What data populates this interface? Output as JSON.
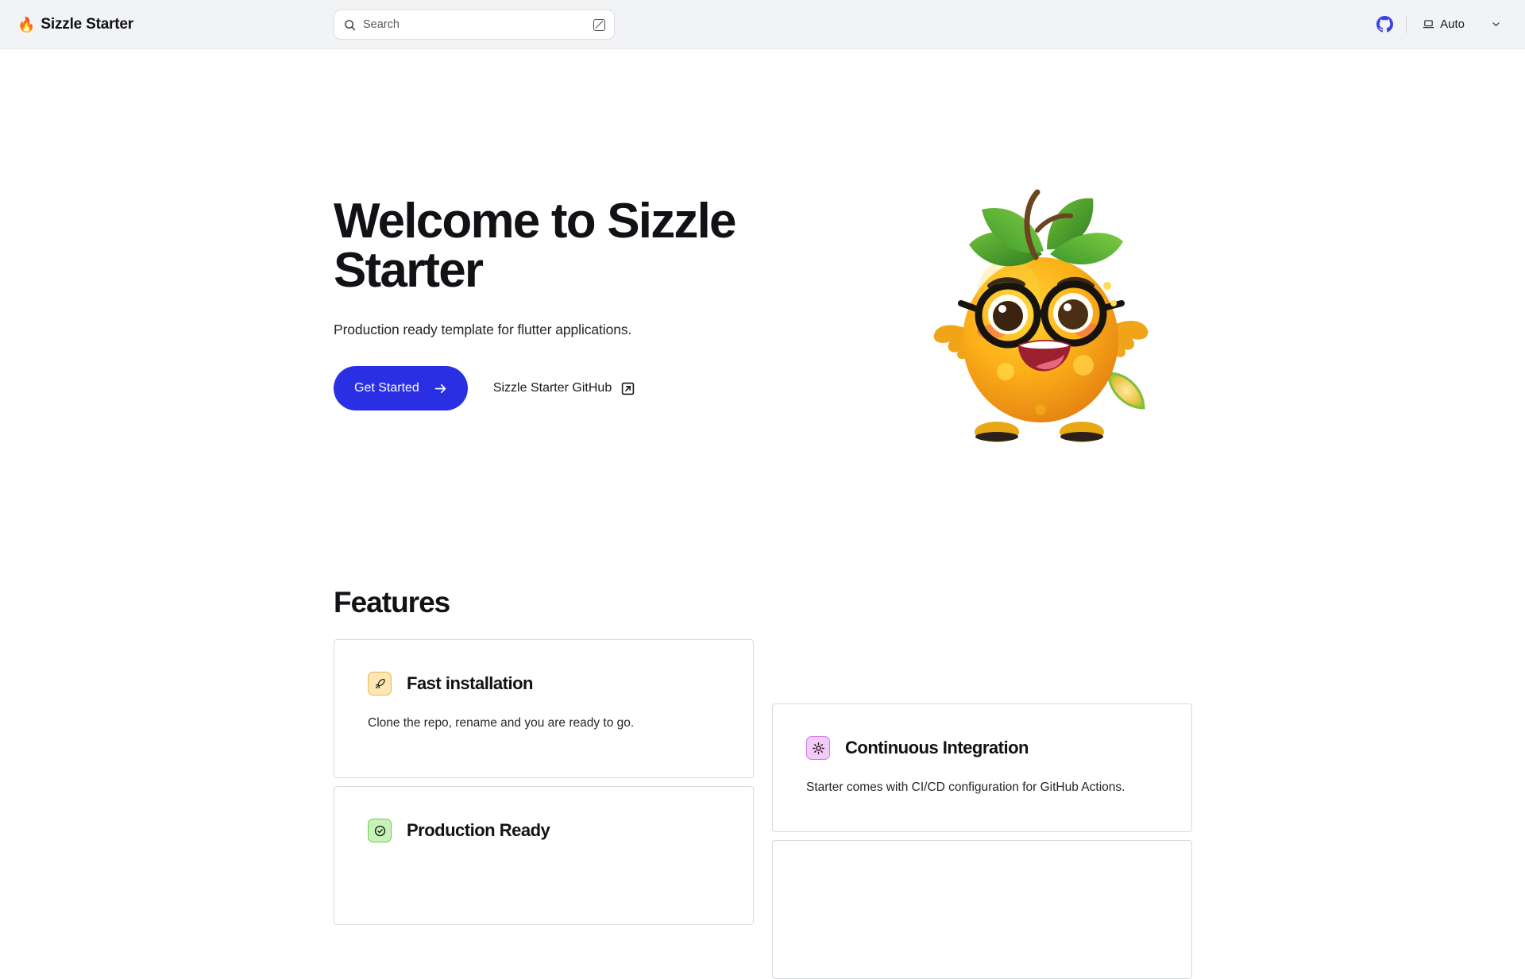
{
  "header": {
    "brand": {
      "flame_icon": "fire-emoji",
      "name": "Sizzle Starter"
    },
    "search": {
      "placeholder": "Search",
      "value": "",
      "icon": "search-icon",
      "shortcut_icon": "slash-key-icon"
    },
    "github_icon": "github-icon",
    "theme": {
      "label": "Auto",
      "icon": "laptop-icon",
      "chevron": "chevron-down-icon"
    }
  },
  "hero": {
    "title": "Welcome to Sizzle Starter",
    "subtitle": "Production ready template for flutter applications.",
    "primary_cta": {
      "label": "Get Started",
      "icon": "arrow-right-icon"
    },
    "secondary_cta": {
      "label": "Sizzle Starter GitHub",
      "icon": "external-link-icon"
    },
    "mascot_alt": "orange-mascot-with-glasses"
  },
  "features": {
    "heading": "Features",
    "cards": [
      {
        "icon": "rocket-icon",
        "badge_color": "#fde7b5",
        "title": "Fast installation",
        "description": "Clone the repo, rename and you are ready to go."
      },
      {
        "icon": "check-circle-icon",
        "badge_color": "#c9f2ba",
        "title": "Production Ready",
        "description": ""
      },
      {
        "icon": "gear-icon",
        "badge_color": "#f0ccf9",
        "title": "Continuous Integration",
        "description": "Starter comes with CI/CD configuration for GitHub Actions."
      },
      {
        "icon": "",
        "badge_color": "",
        "title": "",
        "description": ""
      }
    ]
  },
  "colors": {
    "accent_blue": "#2b2fe4",
    "header_bg": "#f2f3f5",
    "page_bg": "#ffffff",
    "card_border": "#d8dadf",
    "text_primary": "#111215"
  }
}
